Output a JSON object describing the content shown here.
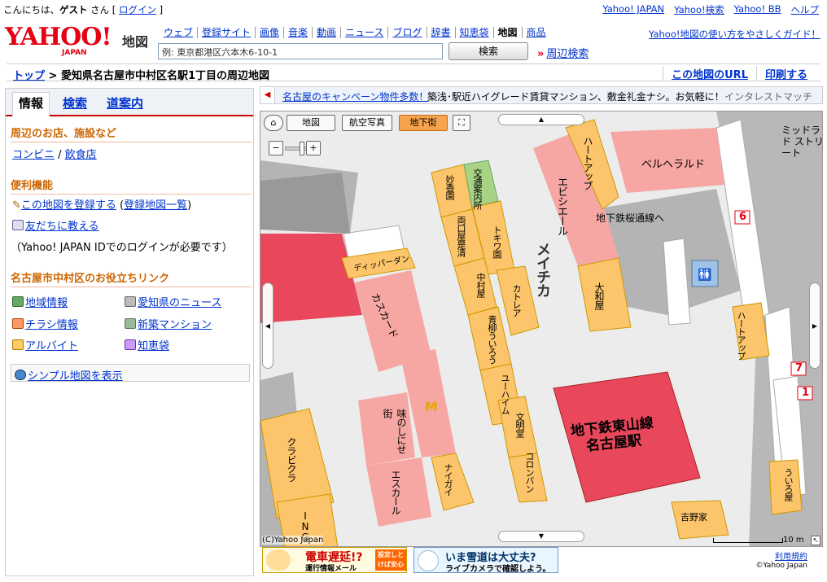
{
  "topbar": {
    "greeting_pre": "こんにちは、",
    "greeting_user": "ゲスト",
    "greeting_post": " さん [ ",
    "login": "ログイン",
    "greeting_end": " ]",
    "links": [
      "Yahoo! JAPAN",
      "Yahoo!検索",
      "Yahoo! BB",
      "ヘルプ"
    ]
  },
  "header": {
    "logo_text": "YAHOO!",
    "logo_sub": "JAPAN",
    "service": "地図",
    "tabs": [
      "ウェブ",
      "登録サイト",
      "画像",
      "音楽",
      "動画",
      "ニュース",
      "ブログ",
      "辞書",
      "知恵袋",
      "地図",
      "商品"
    ],
    "active_tab": "地図",
    "help_link": "Yahoo!地図の使い方をやさしくガイド！",
    "search_value": "例: 東京都港区六本木6-10-1",
    "search_button": "検索",
    "nearby_search": "周辺検索"
  },
  "breadcrumb": {
    "top": "トップ",
    "sep": " > ",
    "current": "愛知県名古屋市中村区名駅1丁目の周辺地図",
    "map_url": "この地図のURL",
    "print": "印刷する"
  },
  "sidebar": {
    "tabs": [
      "情報",
      "検索",
      "道案内"
    ],
    "nearby_heading": "周辺のお店、施設など",
    "nearby_links": [
      "コンビニ",
      "飲食店"
    ],
    "nearby_sep": " / ",
    "convenience_heading": "便利機能",
    "register_map": "この地図を登録する",
    "registered_list": "登録地図一覧",
    "tell_friend": "友だちに教える",
    "login_note": "（Yahoo! JAPAN IDでのログインが必要です）",
    "useful_heading": "名古屋市中村区のお役立ちリンク",
    "useful_links": [
      {
        "label": "地域情報",
        "icon": "globe-book-icon"
      },
      {
        "label": "愛知県のニュース",
        "icon": "news-icon"
      },
      {
        "label": "チラシ情報",
        "icon": "flyer-icon"
      },
      {
        "label": "新築マンション",
        "icon": "building-icon"
      },
      {
        "label": "アルバイト",
        "icon": "job-icon"
      },
      {
        "label": "知恵袋",
        "icon": "chiebukuro-icon"
      }
    ],
    "simple_map": "シンプル地図を表示"
  },
  "ad": {
    "link": "名古屋のキャンペーン物件多数！",
    "text": "築浅･駅近ハイグレード賃貸マンション、敷金礼金ナシ。お気軽に！",
    "source": "インタレストマッチ"
  },
  "map": {
    "modes": [
      "地図",
      "航空写真",
      "地下街"
    ],
    "active_mode": "地下街",
    "copyright": "(C)Yahoo Japan",
    "scale": "10 m",
    "labels": {
      "midland": "ミッドランド ストリート",
      "bellhera": "ベルヘラルド",
      "heart_up_1": "ハートアップ",
      "heart_up_2": "ハートアップ",
      "ebishiel": "エビシエール",
      "sakuradori": "地下鉄桜通線へ",
      "daiwa": "大和屋",
      "meichika": "メイチカ",
      "myokoen": "妙香園",
      "kotsu": "交通案内所",
      "ryoguchiya": "両口屋是清",
      "tokiwa": "トキワ園",
      "nakamuraya": "中村屋",
      "katorea": "カトレア",
      "aoyagi": "青柳ういろう",
      "yuhaimu": "ユーハイム",
      "bunmeido": "文明堂",
      "koronban": "コロンバン",
      "dipper": "ディッパーダン",
      "kasucard": "カスカード",
      "aji": "味のしにせ街",
      "escal": "エスカール",
      "naigai": "ナイガイ",
      "kurabu": "クラビクラ",
      "ing": "ING",
      "higashiyama": "地下鉄東山線\n名古屋駅",
      "kichinoya": "吉野家",
      "uiroya": "ういろ屋",
      "exit6": "6",
      "exit7": "7",
      "exit1": "1"
    }
  },
  "banners": {
    "a_title": "電車遅延!?",
    "a_sub": "運行情報メール",
    "a_badge": "設定しとけば安心",
    "b_title": "いま雪道は大丈夫?",
    "b_sub": "ライブカメラで確認しよう。"
  },
  "footer": {
    "terms": "利用規約",
    "copyright": "©Yahoo Japan"
  },
  "colors": {
    "brand_red": "#e60012",
    "link_blue": "#0033cc",
    "section_orange": "#cc6600",
    "shop_orange": "#fcc56b",
    "shop_pink": "#f6a7a3",
    "station_red": "#e9475b",
    "corridor_gray": "#b0b0b0"
  }
}
